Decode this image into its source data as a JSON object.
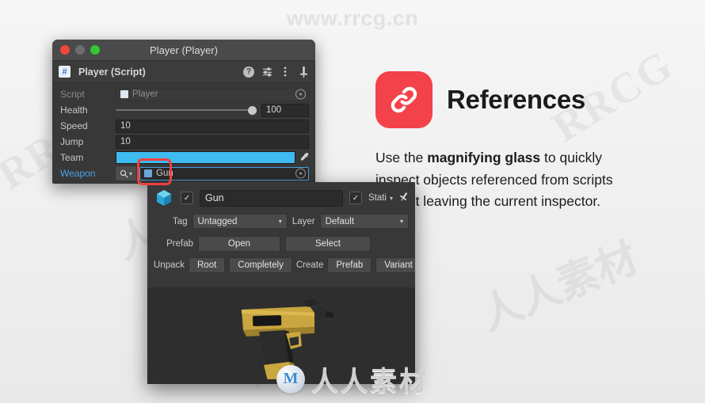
{
  "watermarks": {
    "top": "www.rrcg.cn",
    "bottom_text": "人人素材",
    "bottom_logo_glyph": "M",
    "tiles": [
      "RRCG",
      "人人素材",
      "RRCG",
      "人人素材",
      "RRCG"
    ]
  },
  "reference_panel": {
    "icon": "link-chain-icon",
    "icon_color": "#f4424a",
    "title": "References",
    "body_prefix": "Use the ",
    "body_bold": "magnifying glass",
    "body_suffix": " to quickly inspect objects referenced from scripts without leaving the current inspector."
  },
  "player_window": {
    "title": "Player (Player)",
    "traffic_lights": [
      "close-red",
      "minimize-gray",
      "zoom-green"
    ],
    "component": {
      "icon": "script-file-icon",
      "title": "Player (Script)",
      "header_icons": [
        "help-icon",
        "preset-icon",
        "kebab-menu-icon",
        "pin-icon"
      ]
    },
    "properties": [
      {
        "label": "Script",
        "type": "object",
        "value": "Player",
        "disabled": true
      },
      {
        "label": "Health",
        "type": "slider",
        "value": "100"
      },
      {
        "label": "Speed",
        "type": "text",
        "value": "10"
      },
      {
        "label": "Jump",
        "type": "text",
        "value": "10"
      },
      {
        "label": "Team",
        "type": "color",
        "value": "",
        "color": "#3fbbf0"
      },
      {
        "label": "Weapon",
        "type": "object",
        "value": "Gun",
        "highlighted": true
      }
    ],
    "magnify_icon": "magnifying-glass-icon",
    "highlight_color": "#f03f3f"
  },
  "gun_inspector": {
    "icon": "cube-prefab-icon",
    "enabled_checkbox": true,
    "name": "Gun",
    "static_label": "Stati",
    "static_checked": true,
    "pin_icon": "pin-icon",
    "tag_label": "Tag",
    "tag_value": "Untagged",
    "layer_label": "Layer",
    "layer_value": "Default",
    "prefab_label": "Prefab",
    "prefab_open": "Open",
    "prefab_select": "Select",
    "unpack_label": "Unpack",
    "unpack_root": "Root",
    "unpack_completely": "Completely",
    "create_label": "Create",
    "create_prefab": "Prefab",
    "create_variant": "Variant",
    "preview_asset": "gun-3d-model-preview"
  }
}
